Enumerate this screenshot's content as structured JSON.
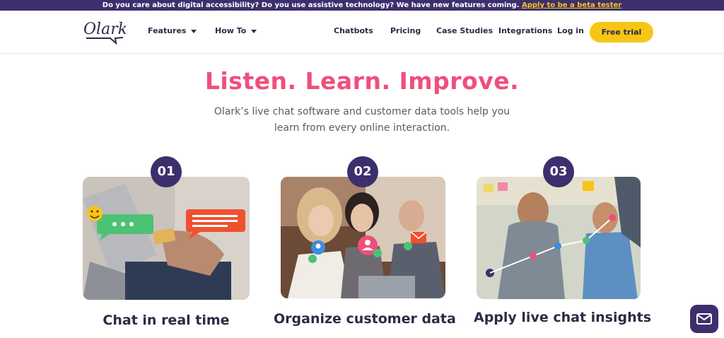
{
  "banner": {
    "text": "Do you care about digital accessibility? Do you use assistive technology? We have new features coming. ",
    "link": "Apply to be a beta tester"
  },
  "nav": {
    "logo": "Olark",
    "features": "Features",
    "howto": "How To",
    "chatbots": "Chatbots",
    "pricing": "Pricing",
    "case_studies": "Case Studies",
    "integrations": "Integrations",
    "login": "Log in",
    "cta": "Free trial"
  },
  "hero": {
    "title": "Listen. Learn. Improve.",
    "subtitle": "Olark’s live chat software and customer data tools help you learn from every online interaction."
  },
  "cards": [
    {
      "number": "01",
      "title": "Chat in real time"
    },
    {
      "number": "02",
      "title": "Organize customer data"
    },
    {
      "number": "03",
      "title": "Apply live chat insights"
    }
  ],
  "colors": {
    "accent_pink": "#ef4f7c",
    "brand_purple": "#3d2f6e",
    "cta_yellow": "#f7c515"
  },
  "icons": [
    "envelope-icon",
    "caret-down-icon",
    "smiley-icon",
    "location-pin-icon",
    "check-icon",
    "user-icon",
    "mail-icon"
  ]
}
